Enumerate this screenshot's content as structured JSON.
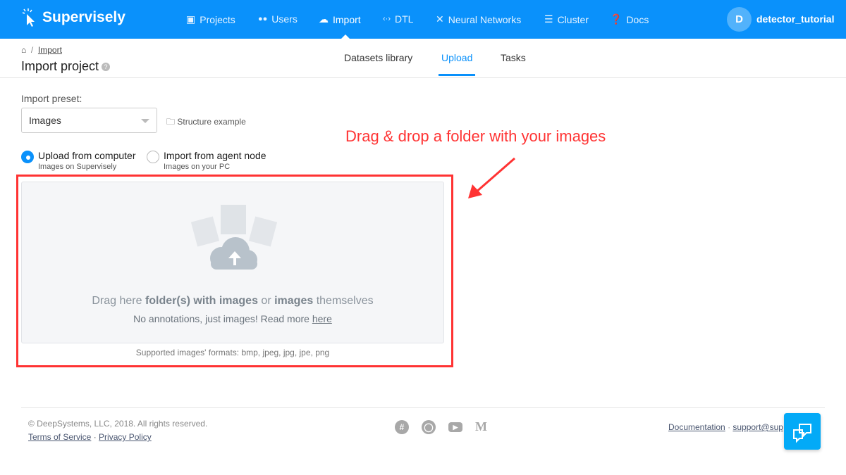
{
  "nav": {
    "brand": "Supervisely",
    "items": [
      {
        "label": "Projects",
        "icon": "images-icon"
      },
      {
        "label": "Users",
        "icon": "users-icon"
      },
      {
        "label": "Import",
        "icon": "cloud-upload-icon"
      },
      {
        "label": "DTL",
        "icon": "code-icon"
      },
      {
        "label": "Neural Networks",
        "icon": "network-icon"
      },
      {
        "label": "Cluster",
        "icon": "list-icon"
      },
      {
        "label": "Docs",
        "icon": "question-icon"
      }
    ],
    "active": "Import",
    "avatar_letter": "D",
    "username": "detector_tutorial"
  },
  "breadcrumb": {
    "link": "Import"
  },
  "page_title": "Import project",
  "tabs": [
    "Datasets library",
    "Upload",
    "Tasks"
  ],
  "active_tab": "Upload",
  "preset": {
    "label": "Import preset:",
    "value": "Images",
    "structure_link": "Structure example"
  },
  "sources": [
    {
      "title": "Upload from computer",
      "subtitle": "Images on Supervisely",
      "selected": true
    },
    {
      "title": "Import from agent node",
      "subtitle": "Images on your PC",
      "selected": false
    }
  ],
  "dropzone": {
    "t1": "Drag here ",
    "b1": "folder(s) with images",
    "t2": " or ",
    "b2": "images",
    "t3": " themselves",
    "line2": "No annotations, just images! Read more ",
    "link": "here",
    "formats": "Supported images' formats: bmp, jpeg, jpg, jpe, png"
  },
  "annotation": "Drag & drop a folder with your images",
  "annotation_color": "#ff3333",
  "footer": {
    "copyright": "© DeepSystems, LLC, 2018. All rights reserved.",
    "terms": "Terms of Service",
    "privacy": "Privacy Policy",
    "documentation": "Documentation",
    "support": "support@sup",
    "sep": "·"
  },
  "colors": {
    "brand": "#0a91fb",
    "chat": "#03aaf7"
  }
}
